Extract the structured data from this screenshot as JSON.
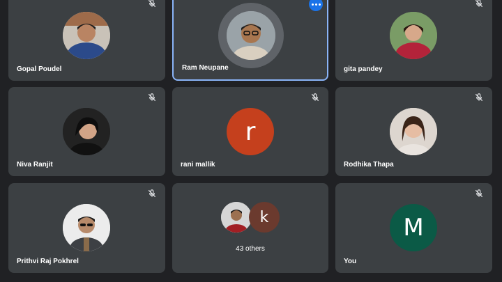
{
  "participants": [
    {
      "name": "Gopal Poudel"
    },
    {
      "name": "Ram Neupane"
    },
    {
      "name": "gita pandey"
    },
    {
      "name": "Niva Ranjit"
    },
    {
      "name": "rani mallik",
      "initial": "r",
      "avatar_color": "#c5401d"
    },
    {
      "name": "Rodhika Thapa"
    },
    {
      "name": "Prithvi Raj Pokhrel"
    },
    {
      "others_count_label": "43 others",
      "initial": "k",
      "avatar_color": "#6b3a2e"
    },
    {
      "name": "You",
      "initial": "M",
      "avatar_color": "#0b5a46"
    }
  ],
  "colors": {
    "background": "#202124",
    "tile": "#3c4043",
    "active_border": "#8ab4f8",
    "menu_button": "#1a73e8"
  }
}
